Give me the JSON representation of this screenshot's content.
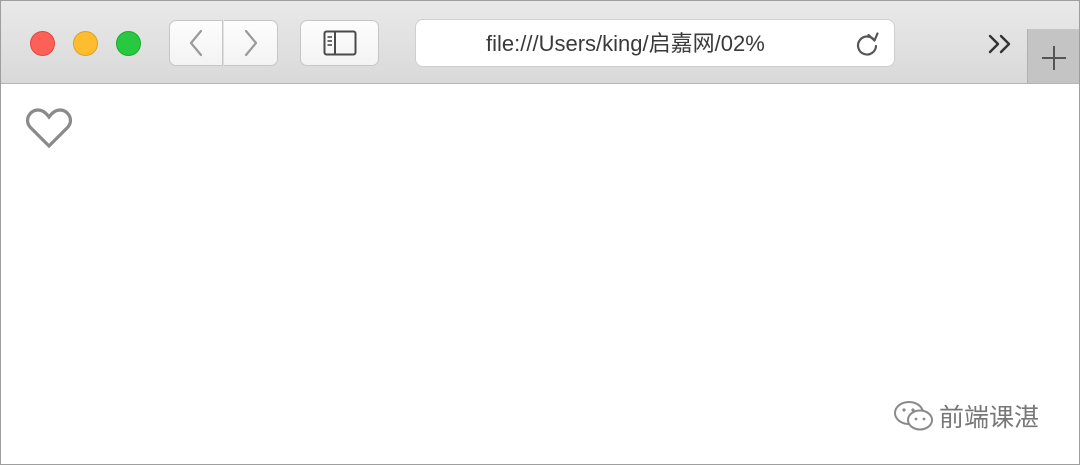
{
  "browser": {
    "address_url": "file:///Users/king/启嘉网/02%",
    "traffic_colors": {
      "close": "#fe5f57",
      "minimize": "#febc2e",
      "maximize": "#28c840"
    },
    "icons": {
      "back": "chevron-left-icon",
      "forward": "chevron-right-icon",
      "sidebar": "sidebar-icon",
      "reload": "reload-icon",
      "overflow": "double-chevron-right-icon",
      "new_tab": "plus-icon"
    }
  },
  "content": {
    "icon": "heart-outline-icon",
    "icon_color": "#8a8a8a"
  },
  "watermark": {
    "text": "前端课湛",
    "icon": "wechat-icon"
  }
}
